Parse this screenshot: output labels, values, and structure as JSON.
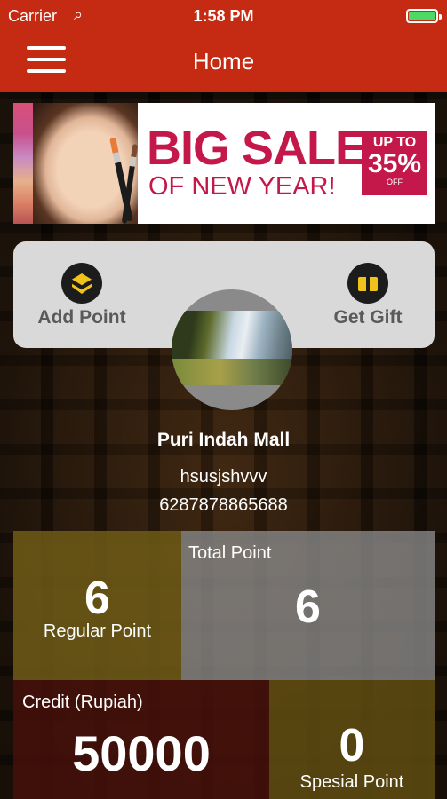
{
  "status_bar": {
    "carrier": "Carrier",
    "wifi_icon": "wifi-icon",
    "time": "1:58 PM",
    "battery_icon": "battery-icon"
  },
  "nav": {
    "title": "Home",
    "menu_icon": "hamburger-menu-icon"
  },
  "banner": {
    "line1": "BIG SALE",
    "line2": "OF NEW YEAR!",
    "badge_top": "UP TO",
    "badge_pct": "35%",
    "badge_off": "OFF"
  },
  "actions": {
    "add_point": {
      "label": "Add Point",
      "icon": "layers-icon"
    },
    "get_gift": {
      "label": "Get Gift",
      "icon": "gift-icon"
    }
  },
  "profile": {
    "name": "Puri Indah Mall",
    "username": "hsusjshvvv",
    "phone": "6287878865688"
  },
  "stats": {
    "regular": {
      "value": "6",
      "label": "Regular Point"
    },
    "total": {
      "value": "6",
      "label": "Total Point"
    },
    "credit": {
      "value": "50000",
      "label": "Credit (Rupiah)"
    },
    "special": {
      "value": "0",
      "label": "Spesial Point"
    }
  },
  "colors": {
    "nav_bar": "#c52a12",
    "banner_text": "#c4184a",
    "icon_accent": "#f1c31a",
    "battery": "#4cd964"
  }
}
